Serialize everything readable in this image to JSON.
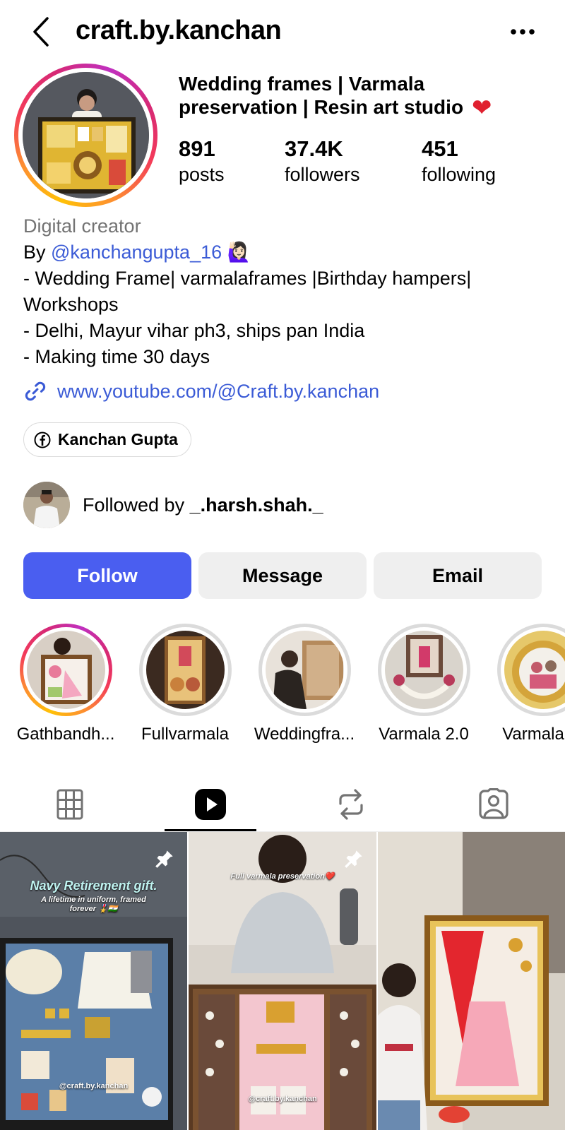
{
  "header": {
    "username": "craft.by.kanchan"
  },
  "profile": {
    "headline": "Wedding frames | Varmala preservation | Resin art studio",
    "headline_emoji": "❤",
    "stats": [
      {
        "count": "891",
        "label": "posts"
      },
      {
        "count": "37.4K",
        "label": "followers"
      },
      {
        "count": "451",
        "label": "following"
      }
    ]
  },
  "bio": {
    "category": "Digital creator",
    "by_prefix": "By ",
    "mention": "@kanchangupta_16",
    "mention_emoji": "🙋🏻‍♀️",
    "line1": "- Wedding Frame| varmalaframes |Birthday hampers| Workshops",
    "line2": "- Delhi, Mayur vihar ph3, ships pan India",
    "line3": "- Making time 30 days",
    "link": "www.youtube.com/@Craft.by.kanchan"
  },
  "facebook_chip": {
    "label": "Kanchan Gupta"
  },
  "followed_by": {
    "prefix": "Followed by ",
    "username": "_.harsh.shah._"
  },
  "actions": {
    "follow": "Follow",
    "message": "Message",
    "email": "Email"
  },
  "highlights": [
    {
      "label": "Gathbandh..."
    },
    {
      "label": "Fullvarmala"
    },
    {
      "label": "Weddingfra..."
    },
    {
      "label": "Varmala 2.0"
    },
    {
      "label": "Varmala re"
    }
  ],
  "tabs": [
    {
      "icon": "grid-icon"
    },
    {
      "icon": "reels-icon",
      "active": true
    },
    {
      "icon": "repost-icon"
    },
    {
      "icon": "tagged-icon"
    }
  ],
  "posts": [
    {
      "title": "Navy Retirement gift.",
      "subtitle": "A lifetime in uniform, framed forever 🎖️🇮🇳",
      "watermark": "@craft.by.kanchan",
      "pinned": true
    },
    {
      "title": "Full varmala preservation❤️",
      "watermark": "@craft.by.kanchan",
      "pinned": true
    },
    {
      "title": ""
    }
  ],
  "colors": {
    "accent": "#4a5ef0",
    "link": "#3b5bd6",
    "secondary_text": "#737373",
    "button_grey": "#efefef"
  }
}
